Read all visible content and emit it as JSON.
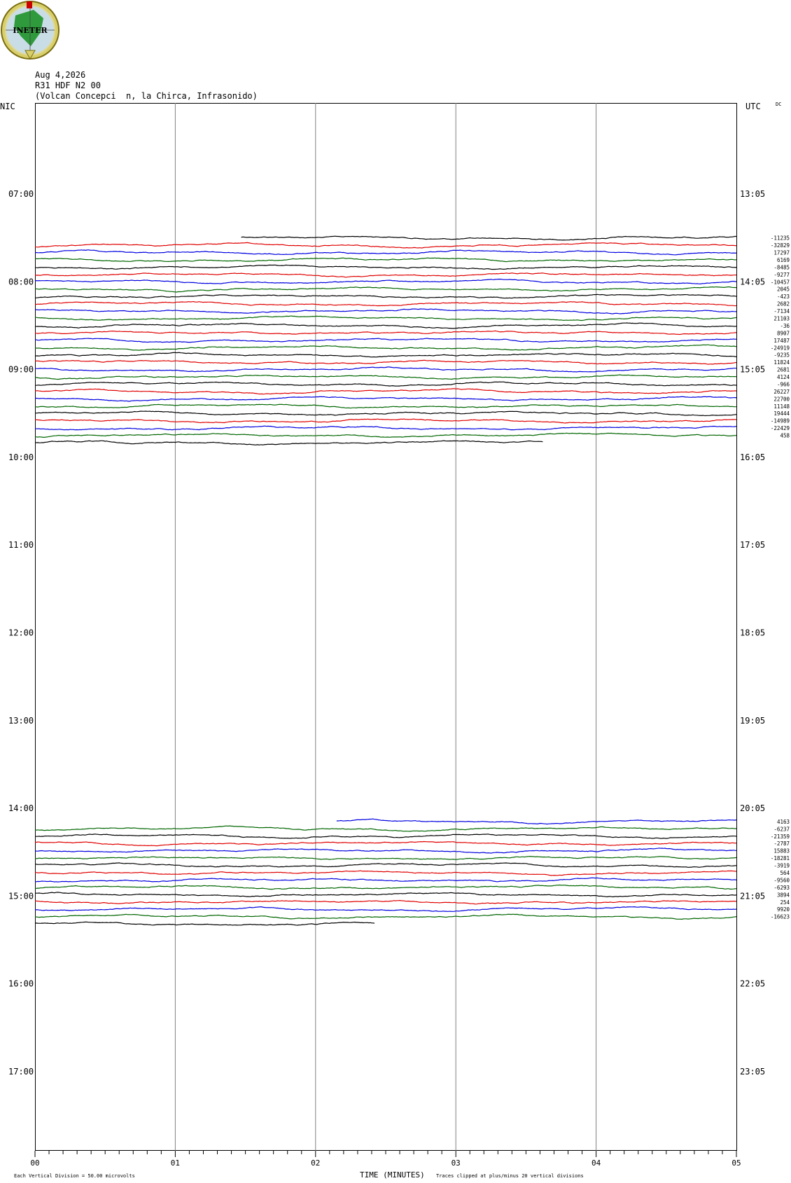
{
  "header": {
    "date": "Aug 4,2026",
    "station": "R31 HDF N2 00",
    "location": "(Volcan Concepci  n, la Chirca, Infrasonido)",
    "left_zone": "NIC",
    "right_zone": "UTC",
    "dc_label": "DC",
    "logo_text": "INETER"
  },
  "footer": {
    "xlabel": "TIME (MINUTES)",
    "division_note": "Each Vertical Division =    50.00 microvolts",
    "clip_note": "Traces clipped at plus/minus 20 vertical divisions"
  },
  "colors": {
    "black": "#000000",
    "red": "#e00000",
    "blue": "#0000e0",
    "green": "#006600",
    "grid": "#808080"
  },
  "chart_data": {
    "type": "line",
    "title": "R31 HDF N2 00",
    "xlabel": "TIME (MINUTES)",
    "xlim": [
      0,
      5
    ],
    "x_ticks": [
      "00",
      "01",
      "02",
      "03",
      "04",
      "05"
    ],
    "grid": true,
    "left_time_labels": [
      "07:00",
      "08:00",
      "09:00",
      "10:00",
      "11:00",
      "12:00",
      "13:00",
      "14:00",
      "15:00",
      "16:00",
      "17:00"
    ],
    "right_time_labels": [
      "13:05",
      "14:05",
      "15:05",
      "16:05",
      "17:05",
      "18:05",
      "19:05",
      "20:05",
      "21:05",
      "22:05",
      "23:05"
    ],
    "color_cycle": [
      "black",
      "red",
      "blue",
      "green"
    ],
    "group1": {
      "start_hour": 7.5,
      "first_trace_start_minute": 1.47,
      "last_trace_end_minute": 3.62,
      "color_start": "black",
      "offsets": [
        "-11235",
        "-32829",
        "17297",
        "6169",
        "-8485",
        "-9277",
        "-10457",
        "2045",
        "-423",
        "2682",
        "-7134",
        "21103",
        "-36",
        "8907",
        "17487",
        "-24919",
        "-9235",
        "11824",
        "2681",
        "4124",
        "-966",
        "26227",
        "22700",
        "11148",
        "19444",
        "-14989",
        "-22429",
        "458"
      ]
    },
    "group2": {
      "start_hour": 14.15,
      "first_trace_start_minute": 2.15,
      "last_trace_end_minute": 2.42,
      "color_start": "blue",
      "offsets": [
        "4163",
        "-6237",
        "-21359",
        "-2787",
        "15883",
        "-18281",
        "-3919",
        "564",
        "-9560",
        "-6293",
        "3894",
        "254",
        "9920",
        "-16623"
      ]
    }
  }
}
